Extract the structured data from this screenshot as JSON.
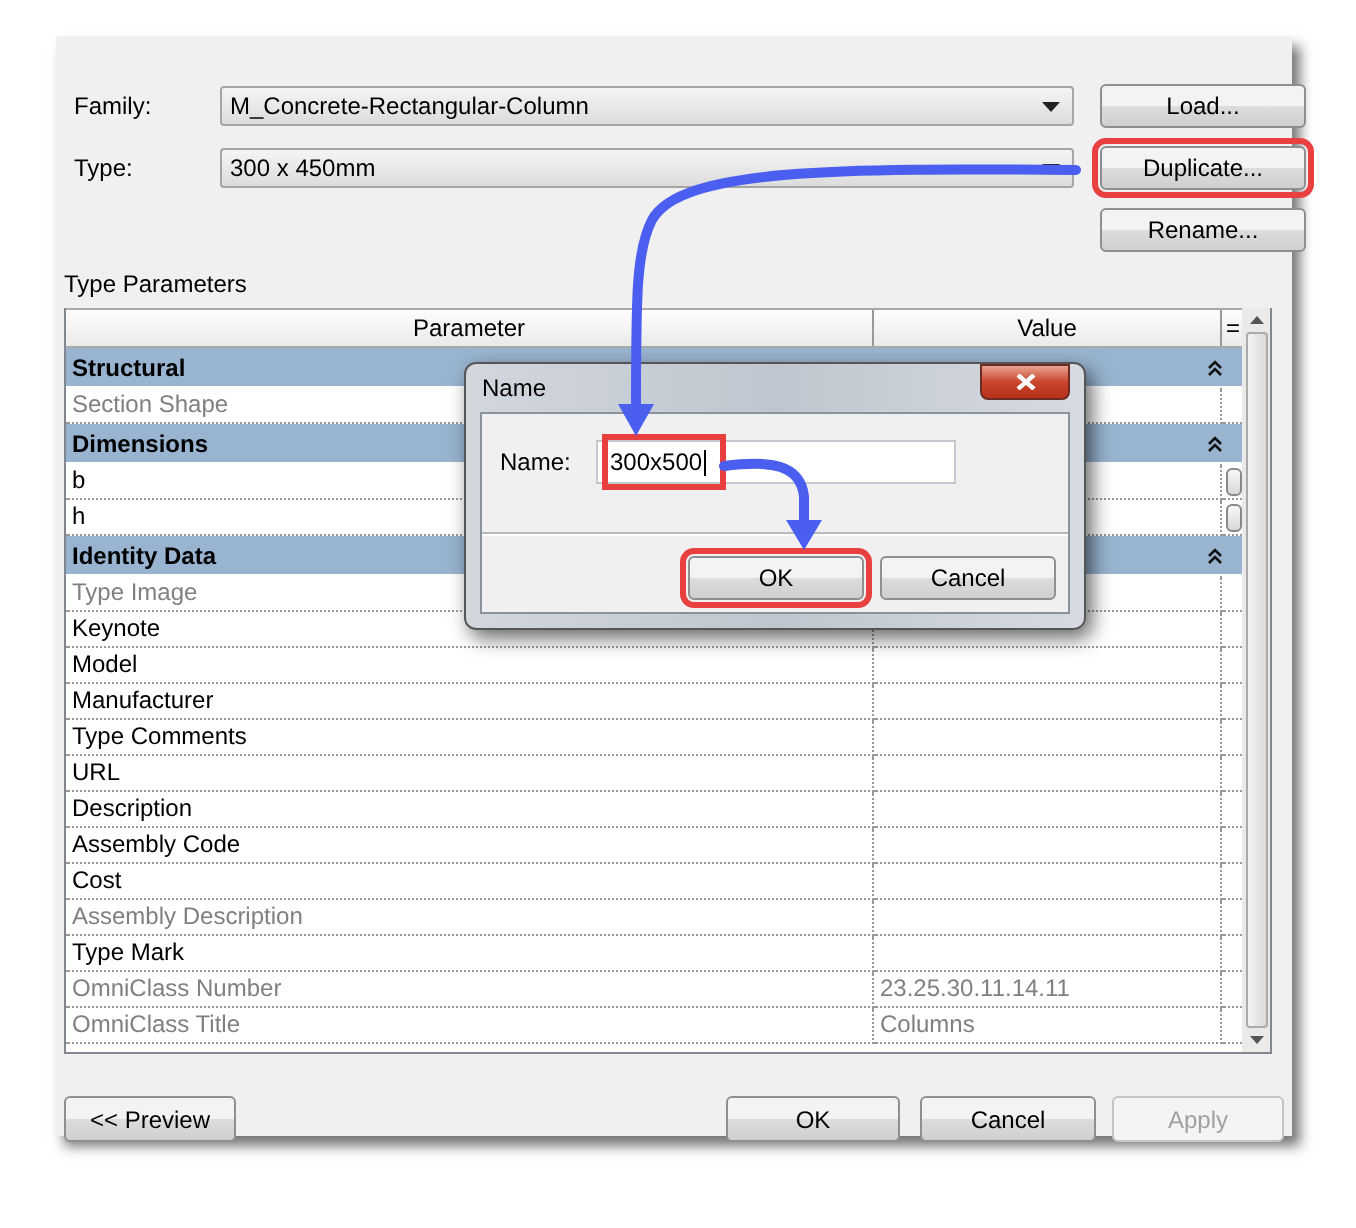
{
  "dialog": {
    "family_label": "Family:",
    "family": "M_Concrete-Rectangular-Column",
    "type_label": "Type:",
    "type": "300 x 450mm",
    "side_buttons": [
      {
        "label": "Load...",
        "highlighted": false
      },
      {
        "label": "Duplicate...",
        "highlighted": true
      },
      {
        "label": "Rename...",
        "highlighted": false
      }
    ],
    "section_title": "Type Parameters",
    "table": {
      "columns": [
        "Parameter",
        "Value",
        "="
      ],
      "rows": [
        {
          "kind": "group",
          "label": "Structural"
        },
        {
          "kind": "param",
          "label": "Section Shape",
          "disabled": true
        },
        {
          "kind": "group",
          "label": "Dimensions"
        },
        {
          "kind": "param",
          "label": "b",
          "disabled": false,
          "button": true
        },
        {
          "kind": "param",
          "label": "h",
          "disabled": false,
          "button": true
        },
        {
          "kind": "group",
          "label": "Identity Data"
        },
        {
          "kind": "param",
          "label": "Type Image",
          "disabled": true
        },
        {
          "kind": "param",
          "label": "Keynote",
          "disabled": false
        },
        {
          "kind": "param",
          "label": "Model",
          "disabled": false
        },
        {
          "kind": "param",
          "label": "Manufacturer",
          "disabled": false
        },
        {
          "kind": "param",
          "label": "Type Comments",
          "disabled": false
        },
        {
          "kind": "param",
          "label": "URL",
          "disabled": false
        },
        {
          "kind": "param",
          "label": "Description",
          "disabled": false
        },
        {
          "kind": "param",
          "label": "Assembly Code",
          "disabled": false
        },
        {
          "kind": "param",
          "label": "Cost",
          "disabled": false
        },
        {
          "kind": "param",
          "label": "Assembly Description",
          "disabled": true
        },
        {
          "kind": "param",
          "label": "Type Mark",
          "disabled": false
        },
        {
          "kind": "param",
          "label": "OmniClass Number",
          "disabled": true,
          "value": "23.25.30.11.14.11"
        },
        {
          "kind": "param",
          "label": "OmniClass Title",
          "disabled": true,
          "value": "Columns"
        }
      ]
    },
    "footer_buttons": [
      {
        "label": "<< Preview",
        "disabled": false
      },
      {
        "label": "OK",
        "disabled": false
      },
      {
        "label": "Cancel",
        "disabled": false
      },
      {
        "label": "Apply",
        "disabled": true
      }
    ]
  },
  "name_dialog": {
    "title": "Name",
    "field_label": "Name:",
    "value": "300x500",
    "field_highlighted": true,
    "buttons": [
      {
        "label": "OK",
        "highlighted": true
      },
      {
        "label": "Cancel",
        "highlighted": false
      }
    ]
  }
}
